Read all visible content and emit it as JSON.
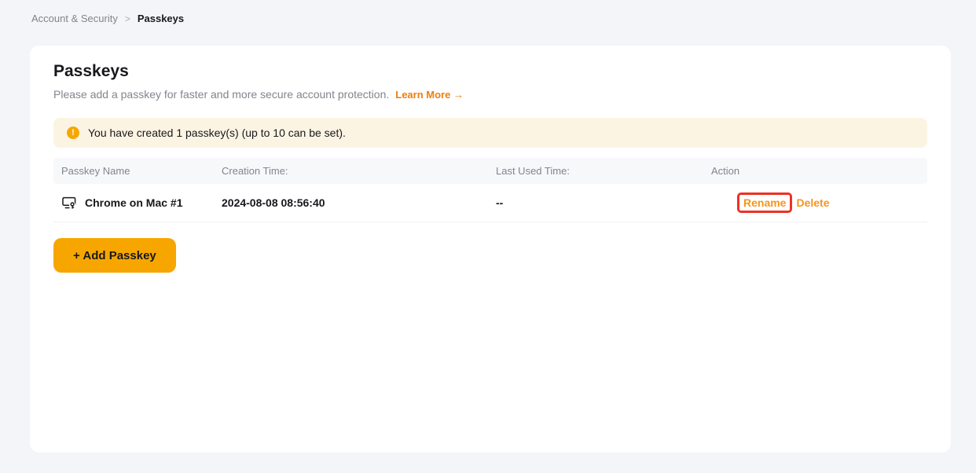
{
  "breadcrumb": {
    "parent": "Account & Security",
    "separator": ">",
    "current": "Passkeys"
  },
  "header": {
    "title": "Passkeys",
    "subtitle": "Please add a passkey for faster and more secure account protection.",
    "learn_more_label": "Learn More",
    "learn_more_arrow": "→"
  },
  "notice": {
    "icon": "alert-circle-icon",
    "icon_glyph": "!",
    "text": "You have created 1 passkey(s) (up to 10 can be set)."
  },
  "table": {
    "headers": [
      "Passkey Name",
      "Creation Time:",
      "Last Used Time:",
      "Action"
    ],
    "rows": [
      {
        "icon": "device-passkey-icon",
        "name": "Chrome on Mac #1",
        "creation_time": "2024-08-08 08:56:40",
        "last_used": "--",
        "rename_label": "Rename",
        "delete_label": "Delete"
      }
    ]
  },
  "add_passkey_button": {
    "label": "+ Add Passkey"
  },
  "annotation": {
    "target": "rename-link",
    "style": "red-highlight-box"
  },
  "colors": {
    "page_bg": "#f4f5f9",
    "accent_button_orange": "#f7a600",
    "learn_more_orange": "#ee7d0d",
    "action_link_orange": "#f7941d",
    "notice_bg": "#fcf4e3",
    "annotation_red": "#ee3124",
    "muted_text": "#81858c",
    "dark_text": "#17181c"
  }
}
